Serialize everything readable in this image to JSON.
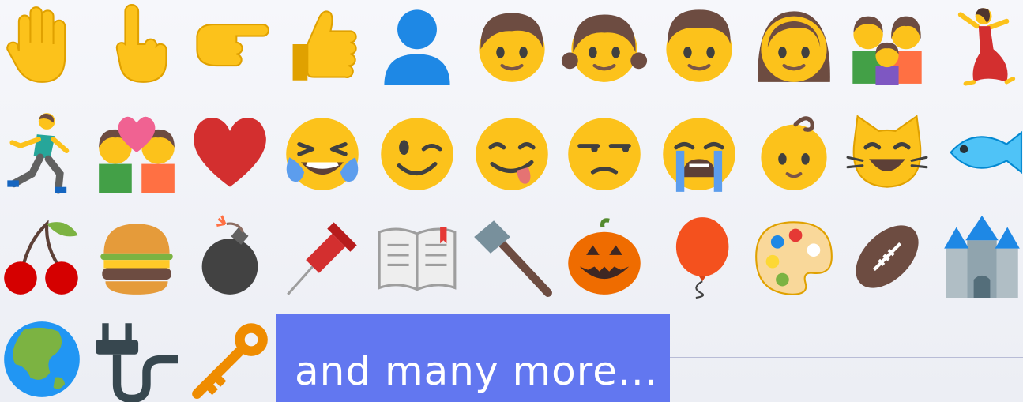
{
  "banner": {
    "text": "and many more..."
  },
  "colors": {
    "background": "#f0f1f6",
    "banner": "#6277f0",
    "skin": "#fcc21b",
    "skin_dark": "#e0a100",
    "face": "#fcc21b",
    "hair": "#6d4c41",
    "heart": "#d32f2f"
  },
  "emoji_rows": [
    [
      "raised-hand-icon",
      "pointing-up-icon",
      "pointing-right-icon",
      "thumbs-up-icon",
      "bust-silhouette-icon",
      "boy-icon",
      "girl-icon",
      "man-icon",
      "woman-icon",
      "family-icon",
      "dancer-icon"
    ],
    [
      "runner-icon",
      "couple-kiss-icon",
      "red-heart-icon",
      "tears-of-joy-icon",
      "winking-face-icon",
      "savoring-face-icon",
      "unamused-face-icon",
      "crying-face-icon",
      "baby-icon",
      "grinning-cat-icon",
      "fish-icon"
    ],
    [
      "cherries-icon",
      "hamburger-icon",
      "bomb-icon",
      "pushpin-icon",
      "open-book-icon",
      "hammer-icon",
      "jack-o-lantern-icon",
      "balloon-icon",
      "artist-palette-icon",
      "football-icon",
      "castle-icon"
    ],
    [
      "globe-asia-icon",
      "electric-plug-icon",
      "key-icon"
    ]
  ]
}
